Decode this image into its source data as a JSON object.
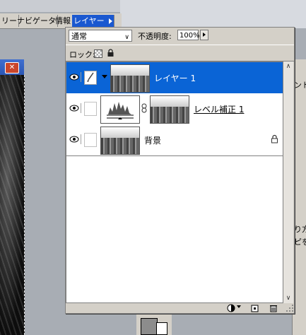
{
  "tabs": [
    {
      "label": "リー",
      "active": false
    },
    {
      "label": "ナビゲータ",
      "active": false
    },
    {
      "label": "情報",
      "active": false
    },
    {
      "label": "レイヤー",
      "active": true
    }
  ],
  "layers_panel": {
    "blend_mode": "通常",
    "opacity_label": "不透明度:",
    "opacity_value": "100%",
    "lock_label": "ロック:",
    "layers": [
      {
        "name": "レイヤー 1",
        "selected": true,
        "type": "pixel",
        "underline": false
      },
      {
        "name": "レベル補正 1",
        "selected": false,
        "type": "adjustment",
        "underline": true
      },
      {
        "name": "背景",
        "selected": false,
        "type": "background",
        "underline": false
      }
    ]
  },
  "right_panel": {
    "lines": [
      "ント",
      "り方",
      "ピを"
    ]
  },
  "colors": {
    "selection": "#0a64d6",
    "panel_bg": "#d4d0c8",
    "tab_active": "#1a58d0"
  }
}
